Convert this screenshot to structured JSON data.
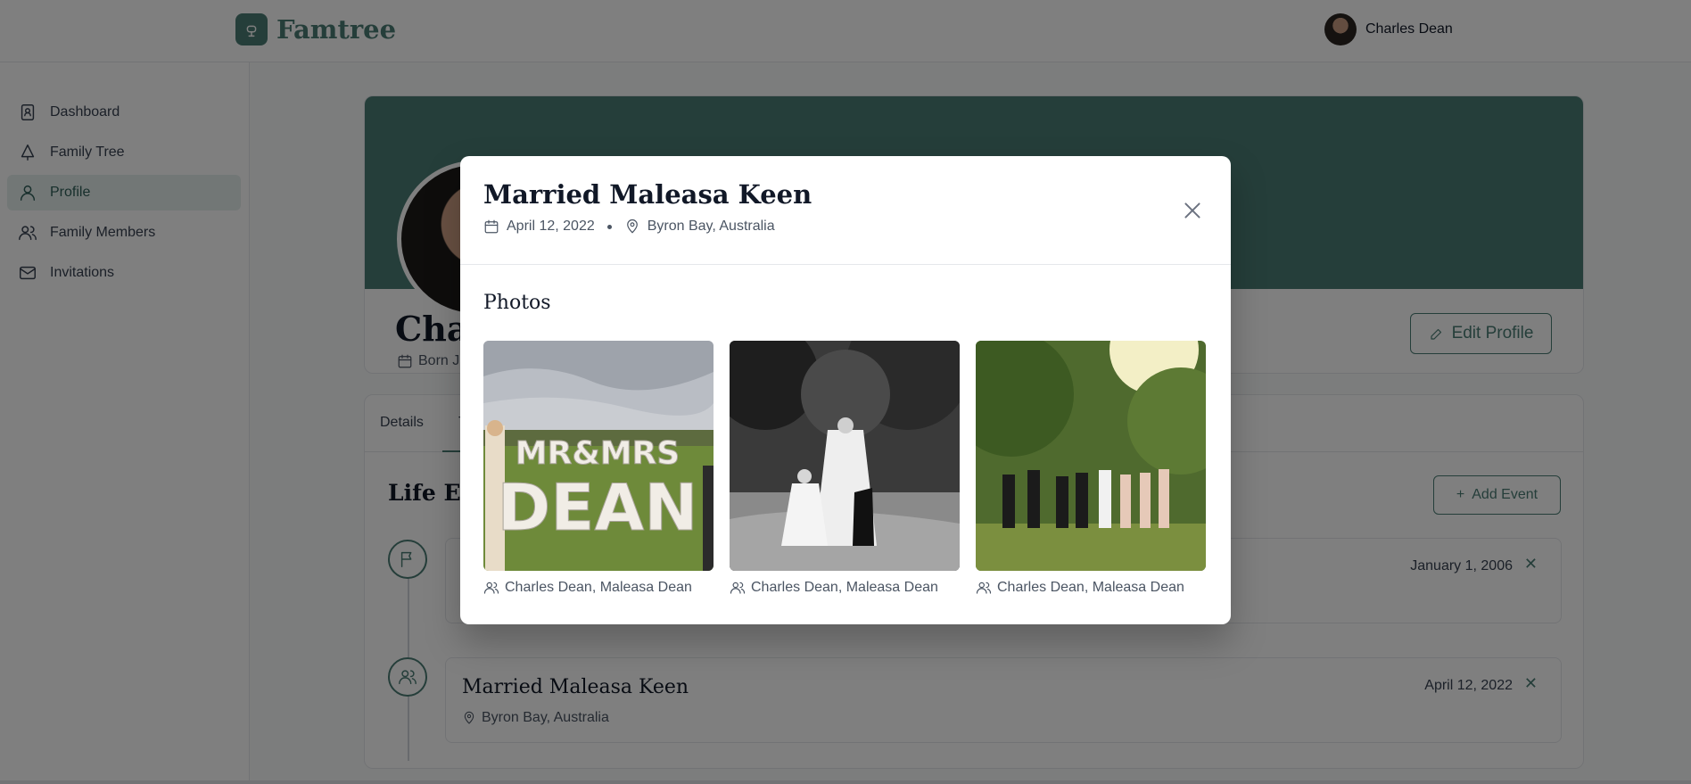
{
  "app": {
    "name": "Famtree"
  },
  "user": {
    "name": "Charles Dean"
  },
  "sidebar": {
    "items": [
      {
        "label": "Dashboard",
        "icon": "contact-book-icon"
      },
      {
        "label": "Family Tree",
        "icon": "tree-icon"
      },
      {
        "label": "Profile",
        "icon": "user-icon",
        "active": true
      },
      {
        "label": "Family Members",
        "icon": "users-icon"
      },
      {
        "label": "Invitations",
        "icon": "mail-icon"
      }
    ]
  },
  "profile": {
    "name_visible": "Char",
    "born_visible": "Born J",
    "edit_label": "Edit Profile"
  },
  "tabs": {
    "details": "Details",
    "timeline_visible": "T"
  },
  "life_events": {
    "title_visible": "Life Eve",
    "add_label": "Add Event",
    "events": [
      {
        "date": "January 1, 2006",
        "icon": "flag-icon"
      },
      {
        "title": "Married Maleasa Keen",
        "location": "Byron Bay, Australia",
        "date": "April 12, 2022",
        "icon": "users-icon"
      }
    ],
    "remove_label": "✕"
  },
  "modal": {
    "title": "Married Maleasa Keen",
    "date": "April 12, 2022",
    "location": "Byron Bay, Australia",
    "photos_heading": "Photos",
    "photos": [
      {
        "sign_line1": "MR&MRS",
        "sign_line2": "DEAN",
        "caption": "Charles Dean, Maleasa Dean"
      },
      {
        "caption": "Charles Dean, Maleasa Dean"
      },
      {
        "caption": "Charles Dean, Maleasa Dean"
      }
    ]
  },
  "colors": {
    "accent": "#4a7c74",
    "overlay": "rgba(0,0,0,0.5)"
  }
}
